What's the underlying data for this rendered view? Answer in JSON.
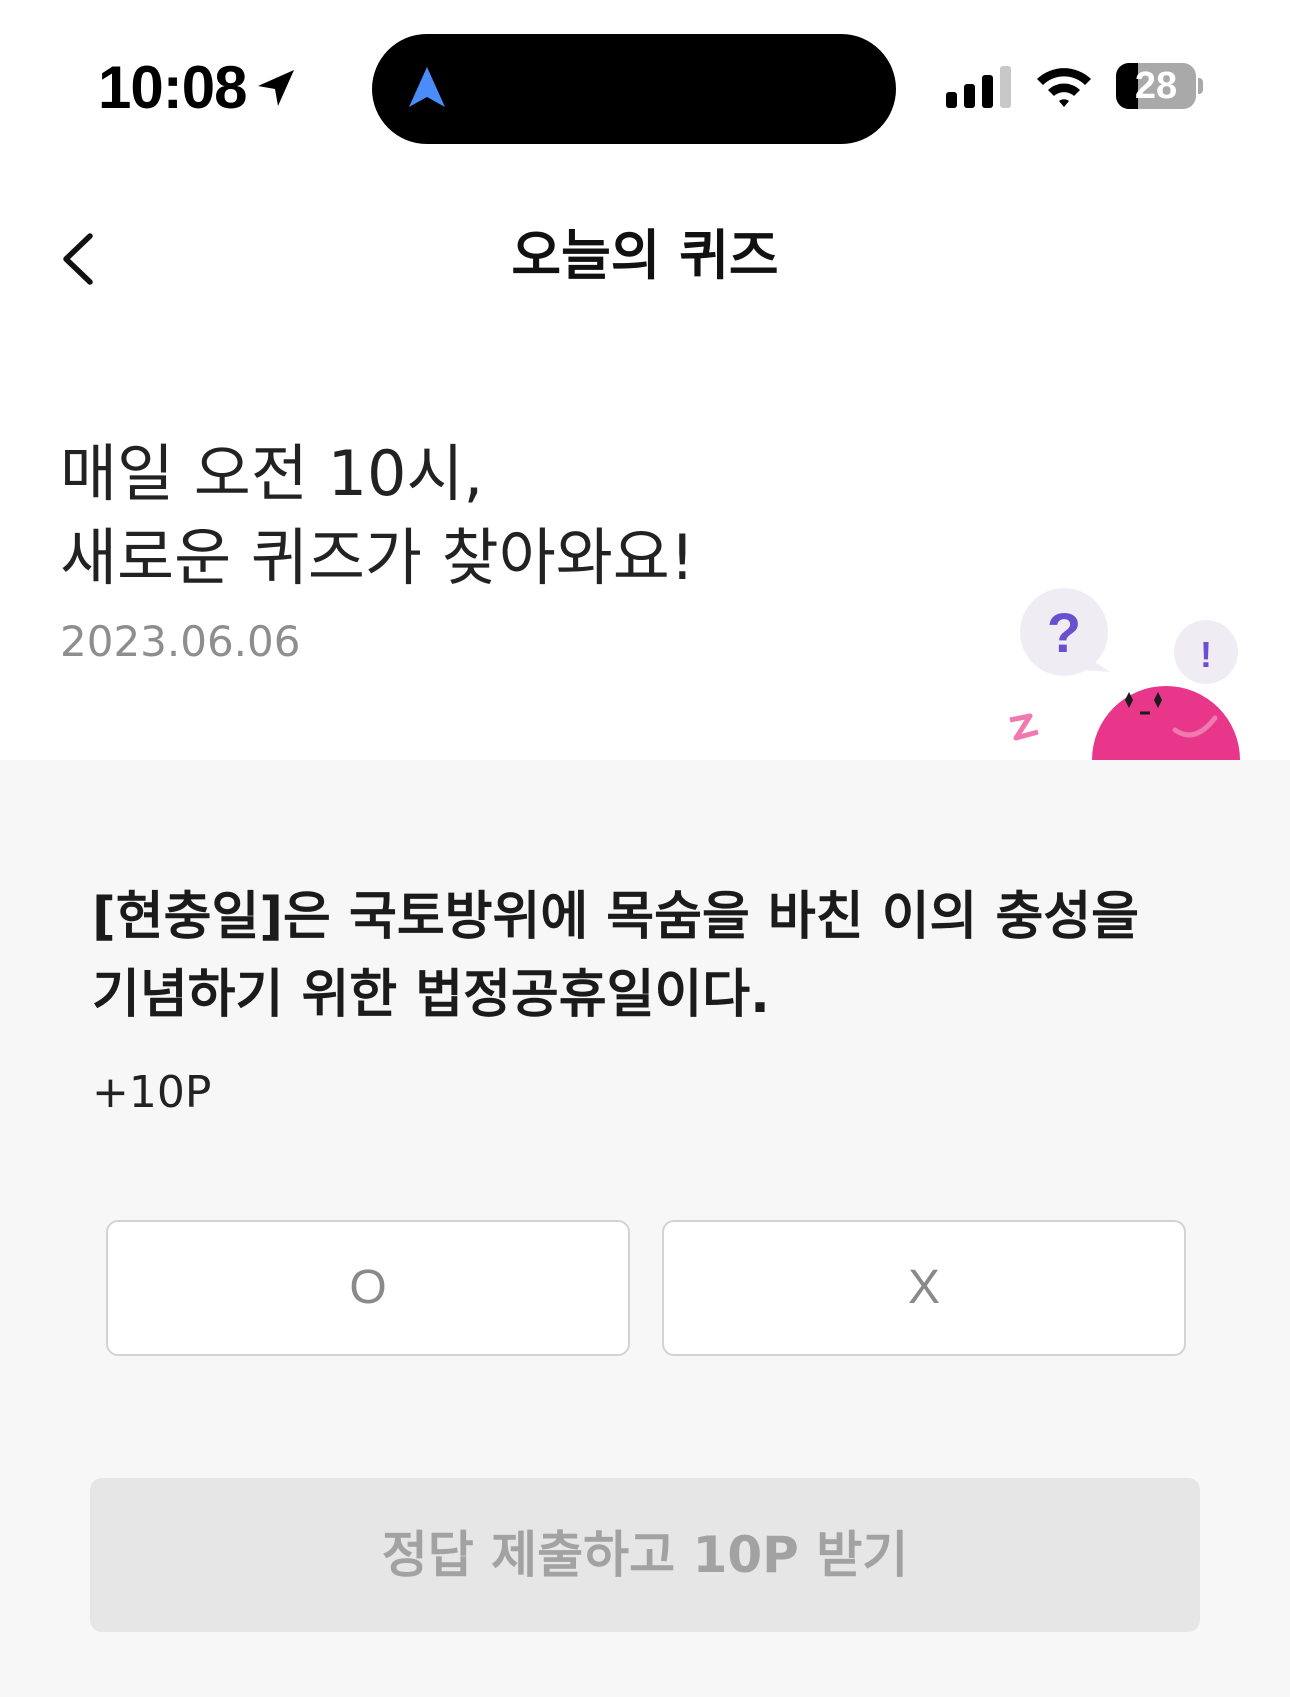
{
  "status_bar": {
    "time": "10:08",
    "battery_percent": "28",
    "battery_level": 0.28,
    "signal_bars": 3,
    "icons": [
      "location-arrow-icon",
      "navigation-arrow-icon",
      "cellular-signal-icon",
      "wifi-icon",
      "battery-icon"
    ],
    "colors": {
      "nav_arrow": "#4a8df8"
    }
  },
  "header": {
    "title": "오늘의 퀴즈",
    "back_icon": "chevron-left-icon"
  },
  "intro": {
    "line1": "매일 오전 10시,",
    "line2": "새로운 퀴즈가 찾아와요!",
    "date": "2023.06.06"
  },
  "mascot": {
    "question_mark": "?",
    "exclamation_mark": "!",
    "colors": {
      "body": "#e8368a",
      "question": "#6a4fd0"
    }
  },
  "quiz": {
    "question": "[현충일]은 국토방위에 목숨을 바친 이의 충성을 기념하기 위한 법정공휴일이다.",
    "reward": "+10P",
    "options": [
      {
        "label": "O"
      },
      {
        "label": "X"
      }
    ],
    "submit_label": "정답 제출하고 10P 받기"
  }
}
